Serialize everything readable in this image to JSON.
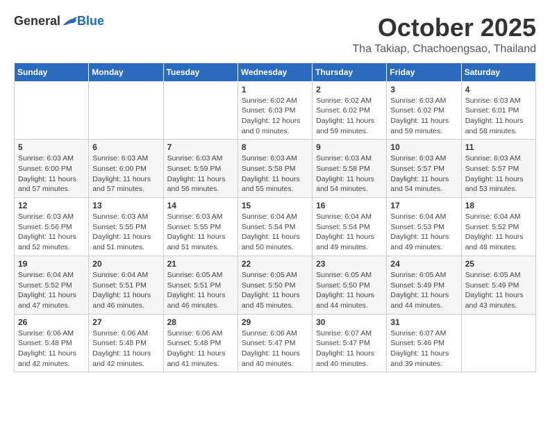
{
  "header": {
    "logo_general": "General",
    "logo_blue": "Blue",
    "month_title": "October 2025",
    "location": "Tha Takiap, Chachoengsao, Thailand"
  },
  "days_of_week": [
    "Sunday",
    "Monday",
    "Tuesday",
    "Wednesday",
    "Thursday",
    "Friday",
    "Saturday"
  ],
  "weeks": [
    [
      {
        "day": "",
        "info": ""
      },
      {
        "day": "",
        "info": ""
      },
      {
        "day": "",
        "info": ""
      },
      {
        "day": "1",
        "info": "Sunrise: 6:02 AM\nSunset: 6:03 PM\nDaylight: 12 hours\nand 0 minutes."
      },
      {
        "day": "2",
        "info": "Sunrise: 6:02 AM\nSunset: 6:02 PM\nDaylight: 11 hours\nand 59 minutes."
      },
      {
        "day": "3",
        "info": "Sunrise: 6:03 AM\nSunset: 6:02 PM\nDaylight: 11 hours\nand 59 minutes."
      },
      {
        "day": "4",
        "info": "Sunrise: 6:03 AM\nSunset: 6:01 PM\nDaylight: 11 hours\nand 58 minutes."
      }
    ],
    [
      {
        "day": "5",
        "info": "Sunrise: 6:03 AM\nSunset: 6:00 PM\nDaylight: 11 hours\nand 57 minutes."
      },
      {
        "day": "6",
        "info": "Sunrise: 6:03 AM\nSunset: 6:00 PM\nDaylight: 11 hours\nand 57 minutes."
      },
      {
        "day": "7",
        "info": "Sunrise: 6:03 AM\nSunset: 5:59 PM\nDaylight: 11 hours\nand 56 minutes."
      },
      {
        "day": "8",
        "info": "Sunrise: 6:03 AM\nSunset: 5:58 PM\nDaylight: 11 hours\nand 55 minutes."
      },
      {
        "day": "9",
        "info": "Sunrise: 6:03 AM\nSunset: 5:58 PM\nDaylight: 11 hours\nand 54 minutes."
      },
      {
        "day": "10",
        "info": "Sunrise: 6:03 AM\nSunset: 5:57 PM\nDaylight: 11 hours\nand 54 minutes."
      },
      {
        "day": "11",
        "info": "Sunrise: 6:03 AM\nSunset: 5:57 PM\nDaylight: 11 hours\nand 53 minutes."
      }
    ],
    [
      {
        "day": "12",
        "info": "Sunrise: 6:03 AM\nSunset: 5:56 PM\nDaylight: 11 hours\nand 52 minutes."
      },
      {
        "day": "13",
        "info": "Sunrise: 6:03 AM\nSunset: 5:55 PM\nDaylight: 11 hours\nand 51 minutes."
      },
      {
        "day": "14",
        "info": "Sunrise: 6:03 AM\nSunset: 5:55 PM\nDaylight: 11 hours\nand 51 minutes."
      },
      {
        "day": "15",
        "info": "Sunrise: 6:04 AM\nSunset: 5:54 PM\nDaylight: 11 hours\nand 50 minutes."
      },
      {
        "day": "16",
        "info": "Sunrise: 6:04 AM\nSunset: 5:54 PM\nDaylight: 11 hours\nand 49 minutes."
      },
      {
        "day": "17",
        "info": "Sunrise: 6:04 AM\nSunset: 5:53 PM\nDaylight: 11 hours\nand 49 minutes."
      },
      {
        "day": "18",
        "info": "Sunrise: 6:04 AM\nSunset: 5:52 PM\nDaylight: 11 hours\nand 48 minutes."
      }
    ],
    [
      {
        "day": "19",
        "info": "Sunrise: 6:04 AM\nSunset: 5:52 PM\nDaylight: 11 hours\nand 47 minutes."
      },
      {
        "day": "20",
        "info": "Sunrise: 6:04 AM\nSunset: 5:51 PM\nDaylight: 11 hours\nand 46 minutes."
      },
      {
        "day": "21",
        "info": "Sunrise: 6:05 AM\nSunset: 5:51 PM\nDaylight: 11 hours\nand 46 minutes."
      },
      {
        "day": "22",
        "info": "Sunrise: 6:05 AM\nSunset: 5:50 PM\nDaylight: 11 hours\nand 45 minutes."
      },
      {
        "day": "23",
        "info": "Sunrise: 6:05 AM\nSunset: 5:50 PM\nDaylight: 11 hours\nand 44 minutes."
      },
      {
        "day": "24",
        "info": "Sunrise: 6:05 AM\nSunset: 5:49 PM\nDaylight: 11 hours\nand 44 minutes."
      },
      {
        "day": "25",
        "info": "Sunrise: 6:05 AM\nSunset: 5:49 PM\nDaylight: 11 hours\nand 43 minutes."
      }
    ],
    [
      {
        "day": "26",
        "info": "Sunrise: 6:06 AM\nSunset: 5:48 PM\nDaylight: 11 hours\nand 42 minutes."
      },
      {
        "day": "27",
        "info": "Sunrise: 6:06 AM\nSunset: 5:48 PM\nDaylight: 11 hours\nand 42 minutes."
      },
      {
        "day": "28",
        "info": "Sunrise: 6:06 AM\nSunset: 5:48 PM\nDaylight: 11 hours\nand 41 minutes."
      },
      {
        "day": "29",
        "info": "Sunrise: 6:06 AM\nSunset: 5:47 PM\nDaylight: 11 hours\nand 40 minutes."
      },
      {
        "day": "30",
        "info": "Sunrise: 6:07 AM\nSunset: 5:47 PM\nDaylight: 11 hours\nand 40 minutes."
      },
      {
        "day": "31",
        "info": "Sunrise: 6:07 AM\nSunset: 5:46 PM\nDaylight: 11 hours\nand 39 minutes."
      },
      {
        "day": "",
        "info": ""
      }
    ]
  ]
}
